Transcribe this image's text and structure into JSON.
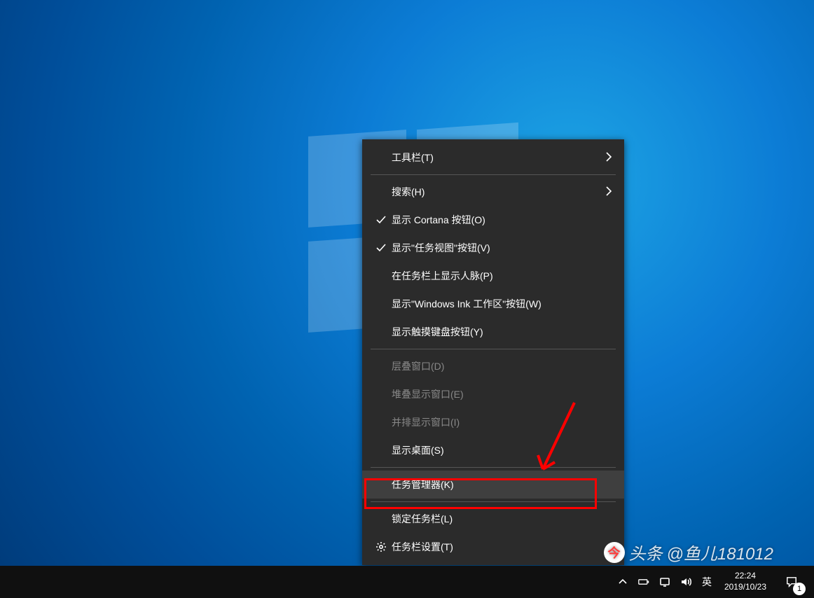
{
  "menu": {
    "toolbars": "工具栏(T)",
    "search": "搜索(H)",
    "show_cortana": "显示 Cortana 按钮(O)",
    "show_taskview": "显示\"任务视图\"按钮(V)",
    "show_people": "在任务栏上显示人脉(P)",
    "show_ink": "显示\"Windows Ink 工作区\"按钮(W)",
    "show_touchkb": "显示触摸键盘按钮(Y)",
    "cascade": "层叠窗口(D)",
    "stack": "堆叠显示窗口(E)",
    "side_by_side": "并排显示窗口(I)",
    "show_desktop": "显示桌面(S)",
    "task_manager": "任务管理器(K)",
    "lock_taskbar": "锁定任务栏(L)",
    "taskbar_settings": "任务栏设置(T)"
  },
  "tray": {
    "ime_lang": "英",
    "time": "22:24",
    "date": "2019/10/23",
    "notif_count": "1"
  },
  "watermark": {
    "prefix": "头条",
    "handle": "@鱼儿181012"
  }
}
